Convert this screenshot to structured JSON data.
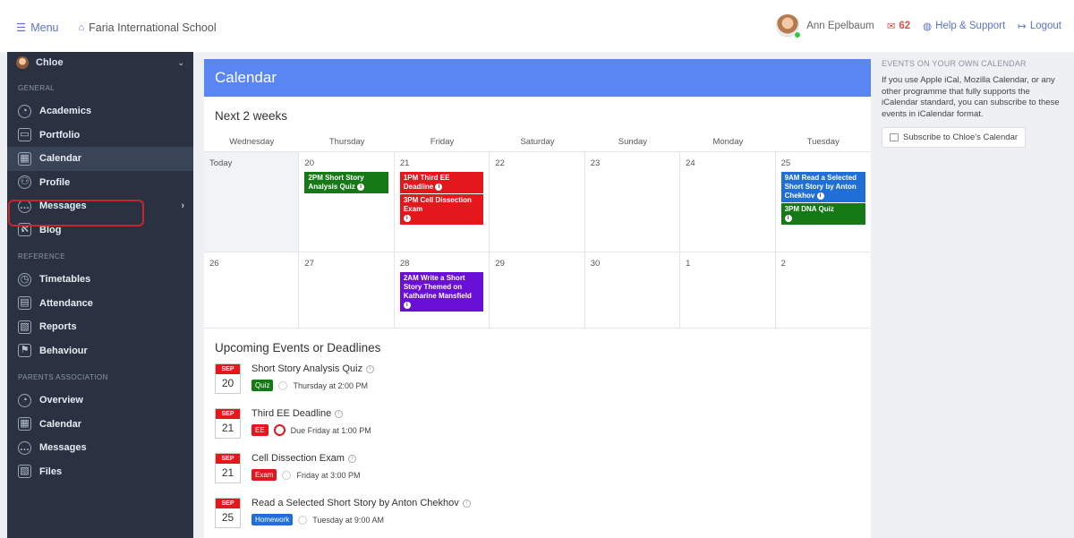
{
  "topbar": {
    "menu_label": "Menu",
    "school_name": "Faria International School",
    "user_name": "Ann Epelbaum",
    "mail_count": "62",
    "help_label": "Help & Support",
    "logout_label": "Logout"
  },
  "sidebar": {
    "user": "Chloe",
    "sections": {
      "general": "GENERAL",
      "reference": "REFERENCE",
      "parents": "PARENTS ASSOCIATION"
    },
    "general_items": [
      "Academics",
      "Portfolio",
      "Calendar",
      "Profile",
      "Messages",
      "Blog"
    ],
    "reference_items": [
      "Timetables",
      "Attendance",
      "Reports",
      "Behaviour"
    ],
    "parents_items": [
      "Overview",
      "Calendar",
      "Messages",
      "Files"
    ]
  },
  "main": {
    "header": "Calendar",
    "next_label": "Next 2 weeks",
    "days": [
      "Wednesday",
      "Thursday",
      "Friday",
      "Saturday",
      "Sunday",
      "Monday",
      "Tuesday"
    ],
    "week1": {
      "today": "Today",
      "d20": "20",
      "d21": "21",
      "d22": "22",
      "d23": "23",
      "d24": "24",
      "d25": "25",
      "ev_20": "2PM Short Story Analysis Quiz",
      "ev_21a": "1PM Third EE Deadline",
      "ev_21b": "3PM Cell Dissection Exam",
      "ev_25a": "9AM Read a Selected Short Story by Anton Chekhov",
      "ev_25b": "3PM DNA Quiz"
    },
    "week2": {
      "d26": "26",
      "d27": "27",
      "d28": "28",
      "d29": "29",
      "d30": "30",
      "d1": "1",
      "d2": "2",
      "ev_28": "2AM Write a Short Story Themed on Katharine Mansfield"
    },
    "upcoming_title": "Upcoming Events or Deadlines",
    "upcoming": [
      {
        "month": "SEP",
        "day": "20",
        "title": "Short Story Analysis Quiz",
        "tag": "Quiz",
        "when": "Thursday at 2:00 PM"
      },
      {
        "month": "SEP",
        "day": "21",
        "title": "Third EE Deadline",
        "tag": "EE",
        "when": "Due Friday at 1:00 PM"
      },
      {
        "month": "SEP",
        "day": "21",
        "title": "Cell Dissection Exam",
        "tag": "Exam",
        "when": "Friday at 3:00 PM"
      },
      {
        "month": "SEP",
        "day": "25",
        "title": "Read a Selected Short Story by Anton Chekhov",
        "tag": "Homework",
        "when": "Tuesday at 9:00 AM"
      }
    ]
  },
  "right": {
    "title": "EVENTS ON YOUR OWN CALENDAR",
    "text": "If you use Apple iCal, Mozilla Calendar, or any other programme that fully supports the iCalendar standard, you can subscribe to these events in iCalendar format.",
    "button": "Subscribe to Chloe's Calendar"
  },
  "colors": {
    "header_blue": "#5a86f4",
    "sidebar_bg": "#2a3242",
    "event_green": "#157a15",
    "event_red": "#e4181c",
    "event_blue": "#1f6fd6",
    "event_purple": "#6a0fd6"
  }
}
